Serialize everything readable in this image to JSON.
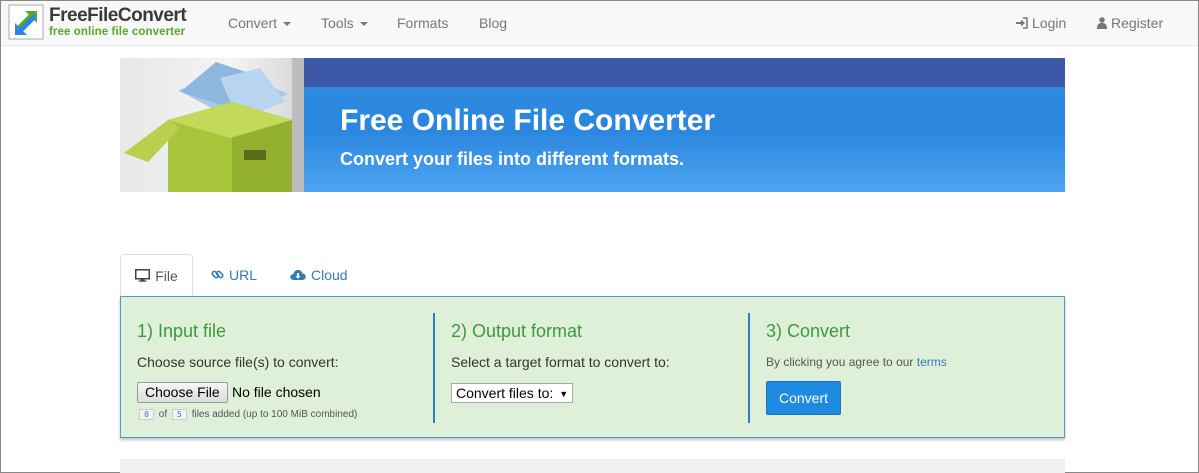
{
  "brand": {
    "name": "FreeFileConvert",
    "tagline": "free online file converter"
  },
  "nav": {
    "items": [
      {
        "label": "Convert",
        "dropdown": true
      },
      {
        "label": "Tools",
        "dropdown": true
      },
      {
        "label": "Formats",
        "dropdown": false
      },
      {
        "label": "Blog",
        "dropdown": false
      }
    ],
    "login": {
      "label": "Login",
      "icon": "sign-in-icon"
    },
    "register": {
      "label": "Register",
      "icon": "user-icon"
    }
  },
  "banner": {
    "title": "Free Online File Converter",
    "subtitle": "Convert your files into different formats."
  },
  "tabs": [
    {
      "label": "File",
      "icon": "monitor-icon",
      "active": true
    },
    {
      "label": "URL",
      "icon": "link-icon",
      "active": false
    },
    {
      "label": "Cloud",
      "icon": "cloud-download-icon",
      "active": false
    }
  ],
  "steps": {
    "input": {
      "title": "1) Input file",
      "description": "Choose source file(s) to convert:",
      "choose_button": "Choose File",
      "no_file_text": "No file chosen",
      "files_added": "0",
      "of_text": "of",
      "max_files": "5",
      "limit_text": "files added (up to 100 MiB combined)"
    },
    "output": {
      "title": "2) Output format",
      "description": "Select a target format to convert to:",
      "select_value": "Convert files to:"
    },
    "convert": {
      "title": "3) Convert",
      "agree_text": "By clicking you agree to our",
      "terms_link": "terms",
      "button": "Convert"
    }
  },
  "colors": {
    "accent": "#337ab7",
    "panel_bg": "#dff0d8",
    "step_title": "#3c9a3c",
    "convert_button": "#1f8ae2",
    "banner_blue": "#2a86de",
    "banner_top": "#3d58a6"
  }
}
